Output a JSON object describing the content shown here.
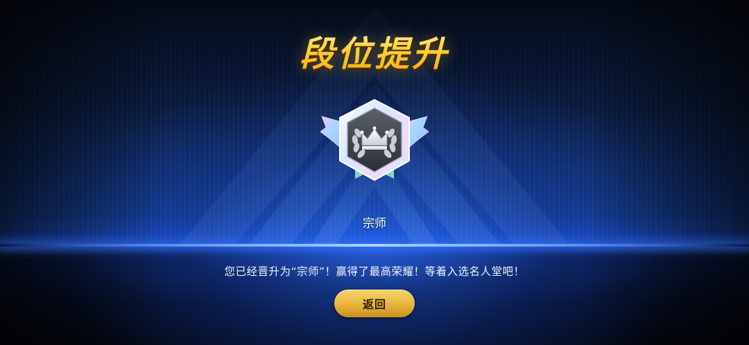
{
  "screen": {
    "title": "段位提升",
    "rank_name": "宗师",
    "message": "您已经晋升为“宗师”！赢得了最高荣耀！等着入选名人堂吧！",
    "back_label": "返回"
  },
  "badge": {
    "icon": "crown-laurel-hexagon-badge"
  },
  "colors": {
    "title_gold": "#ffd23c",
    "button_gold": "#e6b53c",
    "background_blue": "#1c4fd0"
  }
}
